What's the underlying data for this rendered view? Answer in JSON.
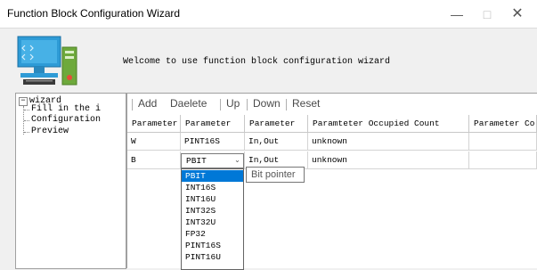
{
  "window": {
    "title": "Function Block Configuration Wizard",
    "minimize_glyph": "—",
    "maximize_glyph": "□",
    "close_glyph": "✕"
  },
  "header": {
    "icon": "computer-icon",
    "welcome_text": "Welcome to use function block configuration wizard"
  },
  "tree": {
    "toggle": "−",
    "root": "wizard",
    "children": [
      "Fill in the i",
      "Configuration",
      "Preview"
    ]
  },
  "toolbar": {
    "add": "Add",
    "delete": "Daelete",
    "up": "Up",
    "down": "Down",
    "reset": "Reset"
  },
  "table": {
    "columns": [
      "Parameter",
      "Parameter",
      "Parameter",
      "Paramteter Occupied Count",
      "Parameter Co"
    ],
    "rows": [
      [
        "W",
        "PINT16S",
        "In,Out",
        "unknown",
        ""
      ],
      [
        "B",
        "PBIT",
        "In,Out",
        "unknown",
        ""
      ]
    ]
  },
  "dropdown": {
    "current": "PBIT",
    "arrow": "⌄",
    "options": [
      "PBIT",
      "INT16S",
      "INT16U",
      "INT32S",
      "INT32U",
      "FP32",
      "PINT16S",
      "PINT16U"
    ],
    "selected": "PBIT"
  },
  "tooltip": {
    "text": "Bit pointer"
  },
  "colors": {
    "selection": "#0078d7",
    "monitor": "#2e9bd6",
    "screen_accent": "#8ed2f2",
    "tower": "#6ea93c"
  }
}
